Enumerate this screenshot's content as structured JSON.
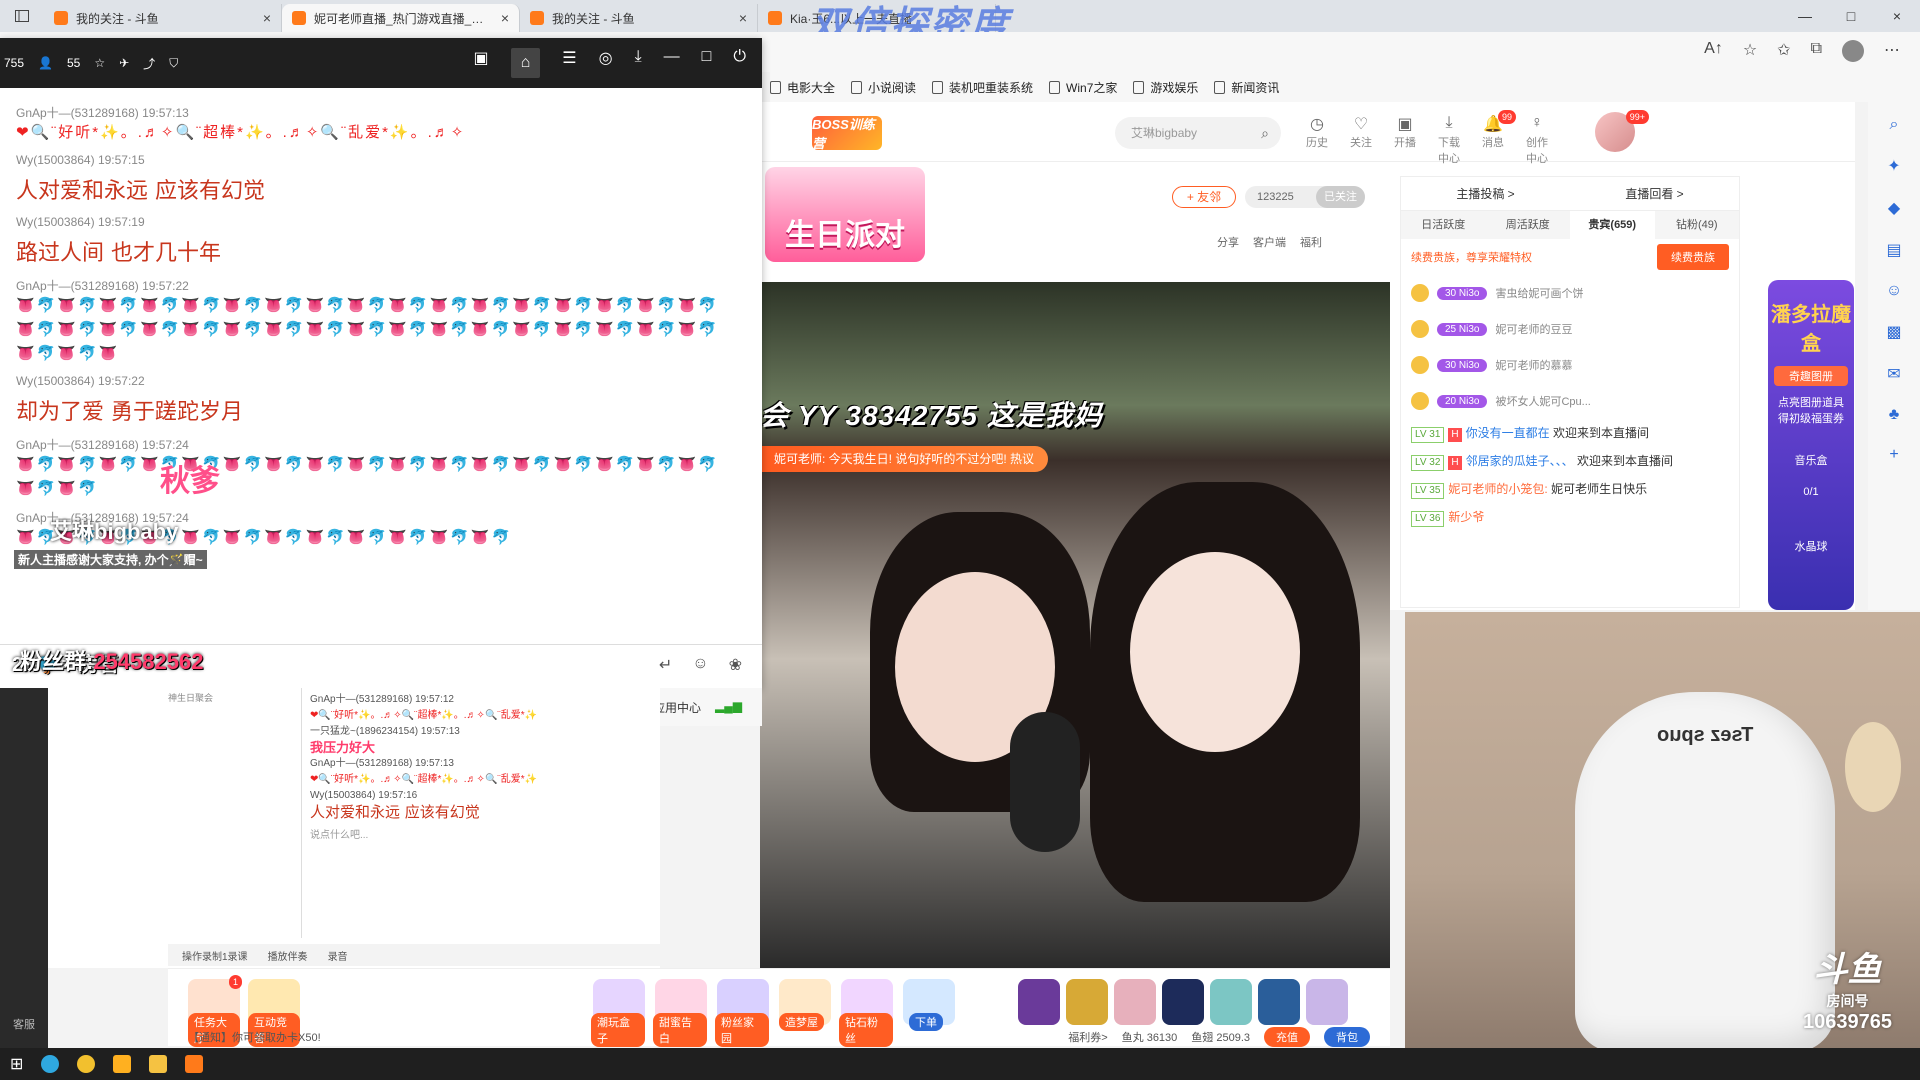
{
  "browser": {
    "tabs": [
      {
        "title": "我的关注 - 斗鱼",
        "close": "×"
      },
      {
        "title": "妮可老师直播_热门游戏直播_斗鱼",
        "close": "×"
      },
      {
        "title": "我的关注 - 斗鱼",
        "close": "×"
      },
      {
        "title": "Kia·王6...以上一夫直播",
        "close": ""
      }
    ],
    "watermark": "双倍探密度",
    "bookmarks": [
      "电影大全",
      "小说阅读",
      "装机吧重装系统",
      "Win7之家",
      "游戏娱乐",
      "新闻资讯"
    ],
    "window_controls": [
      "—",
      "□",
      "×"
    ]
  },
  "douyu": {
    "logo": "BOSS训练营",
    "search_placeholder": "艾琳bigbaby",
    "nav": [
      {
        "label": "历史",
        "icon": "history-icon",
        "glyph": "◷",
        "badge": ""
      },
      {
        "label": "关注",
        "icon": "heart-icon",
        "glyph": "♡",
        "badge": ""
      },
      {
        "label": "开播",
        "icon": "broadcast-icon",
        "glyph": "▣",
        "badge": ""
      },
      {
        "label": "下载中心",
        "icon": "download-icon",
        "glyph": "⤓",
        "badge": ""
      },
      {
        "label": "消息",
        "icon": "bell-icon",
        "glyph": "🔔",
        "badge": "99"
      },
      {
        "label": "创作中心",
        "icon": "bulb-icon",
        "glyph": "♀",
        "badge": ""
      }
    ],
    "user_badge": "99+",
    "birthday_banner": "生日派对",
    "follow_button": "+ 友邻",
    "fans_count": "123225",
    "followed_label": "已关注",
    "room_actions": [
      "分享",
      "客户端",
      "福利"
    ],
    "video_overlay": "会 YY 38342755   这是我妈",
    "video_notice": "妮可老师: 今天我生日! 说句好听的不过分吧!   热议"
  },
  "rank_panel": {
    "top_links": [
      "主播投稿 >",
      "直播回看 >"
    ],
    "tabs": [
      "日活跃度",
      "周活跃度",
      "贵宾(659)",
      "钻粉(49)"
    ],
    "active_tab": 2,
    "vip_notice": "续费贵族，尊享荣耀特权",
    "vip_button": "续费贵族",
    "rank_items": [
      {
        "level": "30 Ni3o",
        "text": "害虫给妮可画个饼"
      },
      {
        "level": "25 Ni3o",
        "text": "妮可老师的豆豆"
      },
      {
        "level": "30 Ni3o",
        "text": "妮可老师的慕慕"
      },
      {
        "level": "20 Ni3o",
        "text": "被坏女人妮可Cpu..."
      }
    ],
    "chat_lines": [
      {
        "lv": "LV 31",
        "user": "你没有一直都在",
        "text": "欢迎来到本直播间"
      },
      {
        "lv": "LV 32",
        "user": "邻居家的瓜娃子、、、",
        "text": "欢迎来到本直播间"
      },
      {
        "lv": "LV 35",
        "user": "妮可老师的小笼包:",
        "text": "妮可老师生日快乐"
      },
      {
        "lv": "LV 36",
        "user": "新少爷",
        "text": ""
      }
    ]
  },
  "pandora": {
    "title": "潘多拉魔盒",
    "subtitle": "奇趣图册",
    "desc": "点亮图册道具得初级福蛋券",
    "item1": "音乐盒",
    "progress": "0/1",
    "item2": "水晶球"
  },
  "chat_window": {
    "title_left": [
      "755",
      "55"
    ],
    "messages": [
      {
        "meta": "GnAp十—(531289168)  19:57:13",
        "type": "emo",
        "content": "❤🔍¨好听*✨。.♬✧🔍¨超棒*✨。.♬✧🔍¨乱爱*✨。.♬✧"
      },
      {
        "meta": "Wy(15003864)  19:57:15",
        "type": "text",
        "content": "人对爱和永远  应该有幻觉"
      },
      {
        "meta": "Wy(15003864)  19:57:19",
        "type": "text",
        "content": "路过人间  也才几十年"
      },
      {
        "meta": "GnAp十—(531289168)  19:57:22",
        "type": "emo",
        "content": "👅🐬👅🐬👅🐬👅🐬👅🐬👅🐬👅🐬👅🐬👅🐬👅🐬👅🐬👅🐬👅🐬👅🐬👅🐬👅🐬👅🐬👅🐬👅🐬👅🐬👅🐬👅🐬👅🐬👅🐬👅🐬👅🐬👅🐬👅🐬👅🐬👅🐬👅🐬👅🐬👅🐬👅🐬👅🐬👅🐬👅"
      },
      {
        "meta": "Wy(15003864)  19:57:22",
        "type": "text",
        "content": "却为了爱  勇于蹉跎岁月"
      },
      {
        "meta": "GnAp十—(531289168)  19:57:24",
        "type": "emo",
        "content": "👅🐬👅🐬👅🐬👅🐬👅🐬👅🐬👅🐬👅🐬👅🐬👅🐬👅🐬👅🐬👅🐬👅🐬👅🐬👅🐬👅🐬👅🐬👅🐬"
      },
      {
        "meta": "GnAp十—(531289168)  19:57:24",
        "type": "emo",
        "content": "👅🐬👅🐬👅🐬👅🐬👅🐬👅🐬👅🐬👅🐬👅🐬👅🐬👅🐬👅🐬"
      }
    ],
    "input_placeholder": "说点什么吧...",
    "footer_left": [
      "播放伴奏",
      "录音"
    ],
    "footer_right": "应用中心",
    "overlay_tiktok": "艾琳bigbaby",
    "overlay_autumn": "秋爹",
    "overlay_new_anchor": "新人主播感谢大家支持, 办个🪄赗~",
    "house_label": "2X🐦= 房管",
    "fans_group_label": "粉丝群:",
    "fans_group_number": "254582562"
  },
  "lower_panel": {
    "col1_title": "神生日聚会",
    "col2_lines": [
      {
        "meta": "GnAp十—(531289168)  19:57:12",
        "content": "❤🔍¨好听*✨。.♬✧🔍¨超棒*✨。.♬✧🔍¨乱爱*✨"
      },
      {
        "meta": "一只猛龙~(1896234154)  19:57:13",
        "content": "我压力好大"
      },
      {
        "meta": "GnAp十—(531289168)  19:57:13",
        "content": "❤🔍¨好听*✨。.♬✧🔍¨超棒*✨。.♬✧🔍¨乱爱*✨"
      },
      {
        "meta": "Wy(15003864)  19:57:16",
        "content": "人对爱和永远  应该有幻觉"
      }
    ],
    "input_placeholder": "说点什么吧...",
    "bar_items": [
      "操作录制1录课",
      "播放伴奏",
      "录音"
    ],
    "left_bar_label": "客服"
  },
  "gift_bar": {
    "left_items": [
      {
        "label": "任务大厅",
        "badge": "1"
      },
      {
        "label": "互动竞答",
        "badge": ""
      }
    ],
    "center_items": [
      "潮玩盒子",
      "甜蜜告白",
      "粉丝家园",
      "造梦屋",
      "钻石粉丝",
      "下单"
    ],
    "notice": "【通知】你可领取办卡X50!",
    "footer": {
      "welfare": "福利券>",
      "fish_ball": "鱼丸 36130",
      "fish_wing": "鱼翅 2509.3",
      "recharge": "充值",
      "backpack": "背包"
    }
  },
  "cam2": {
    "chair_text": "Tsez spuo",
    "brand": "斗鱼",
    "room_label": "房间号",
    "room_id": "10639765"
  }
}
